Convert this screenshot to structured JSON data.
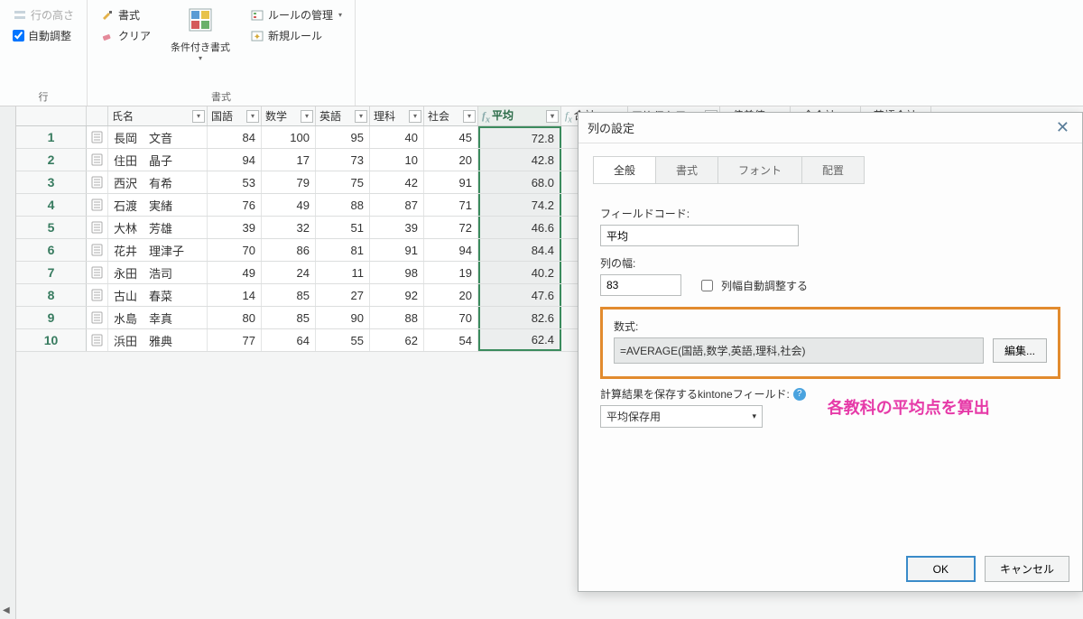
{
  "ribbon": {
    "row_height": "行の高さ",
    "auto_adjust": "自動調整",
    "row_group": "行",
    "format": "書式",
    "clear": "クリア",
    "cond_format": "条件付き書式",
    "format_group": "書式",
    "rule_manage": "ルールの管理",
    "new_rule": "新規ルール"
  },
  "columns": {
    "name": "氏名",
    "kokugo": "国語",
    "suugaku": "数学",
    "eigo": "英語",
    "rika": "理科",
    "shakai": "社会",
    "avg": "平均",
    "sum": "合計",
    "save": "平均保存用",
    "dev": "偏差値",
    "gt": "全合計",
    "engsum": "英語合計"
  },
  "rows": [
    {
      "n": "1",
      "name": "長岡　文音",
      "k": "84",
      "s": "100",
      "e": "95",
      "r": "40",
      "sh": "45",
      "avg": "72.8"
    },
    {
      "n": "2",
      "name": "住田　晶子",
      "k": "94",
      "s": "17",
      "e": "73",
      "r": "10",
      "sh": "20",
      "avg": "42.8"
    },
    {
      "n": "3",
      "name": "西沢　有希",
      "k": "53",
      "s": "79",
      "e": "75",
      "r": "42",
      "sh": "91",
      "avg": "68.0"
    },
    {
      "n": "4",
      "name": "石渡　実緒",
      "k": "76",
      "s": "49",
      "e": "88",
      "r": "87",
      "sh": "71",
      "avg": "74.2"
    },
    {
      "n": "5",
      "name": "大林　芳雄",
      "k": "39",
      "s": "32",
      "e": "51",
      "r": "39",
      "sh": "72",
      "avg": "46.6"
    },
    {
      "n": "6",
      "name": "花井　理津子",
      "k": "70",
      "s": "86",
      "e": "81",
      "r": "91",
      "sh": "94",
      "avg": "84.4"
    },
    {
      "n": "7",
      "name": "永田　浩司",
      "k": "49",
      "s": "24",
      "e": "11",
      "r": "98",
      "sh": "19",
      "avg": "40.2"
    },
    {
      "n": "8",
      "name": "古山　春菜",
      "k": "14",
      "s": "85",
      "e": "27",
      "r": "92",
      "sh": "20",
      "avg": "47.6"
    },
    {
      "n": "9",
      "name": "水島　幸真",
      "k": "80",
      "s": "85",
      "e": "90",
      "r": "88",
      "sh": "70",
      "avg": "82.6"
    },
    {
      "n": "10",
      "name": "浜田　雅典",
      "k": "77",
      "s": "64",
      "e": "55",
      "r": "62",
      "sh": "54",
      "avg": "62.4"
    }
  ],
  "dialog": {
    "title": "列の設定",
    "tabs": {
      "general": "全般",
      "format": "書式",
      "font": "フォント",
      "align": "配置"
    },
    "field_code_label": "フィールドコード:",
    "field_code_value": "平均",
    "width_label": "列の幅:",
    "width_value": "83",
    "auto_width": "列幅自動調整する",
    "formula_label": "数式:",
    "formula_value": "=AVERAGE(国語,数学,英語,理科,社会)",
    "edit_btn": "編集...",
    "save_label": "計算結果を保存するkintoneフィールド:",
    "save_value": "平均保存用",
    "callout": "各教科の平均点を算出",
    "ok": "OK",
    "cancel": "キャンセル"
  }
}
